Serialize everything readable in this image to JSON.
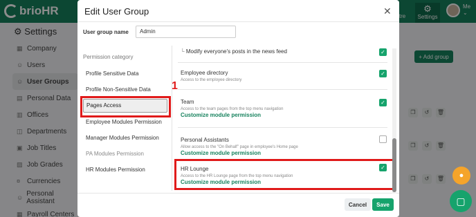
{
  "topbar": {
    "logo": "brioHR",
    "centre_label": "entre",
    "settings_label": "Settings",
    "user_label": "Me"
  },
  "page": {
    "title": "Settings",
    "add_group_label": "+ Add group"
  },
  "sidebar": {
    "items": [
      {
        "label": "Company",
        "icon": "building-icon"
      },
      {
        "label": "Users",
        "icon": "users-icon"
      },
      {
        "label": "User Groups",
        "icon": "user-groups-icon",
        "active": true
      },
      {
        "label": "Personal Data",
        "icon": "person-card-icon"
      },
      {
        "label": "Offices",
        "icon": "office-icon"
      },
      {
        "label": "Departments",
        "icon": "department-icon"
      },
      {
        "label": "Job Titles",
        "icon": "briefcase-icon"
      },
      {
        "label": "Job Grades",
        "icon": "grades-icon"
      },
      {
        "label": "Currencies",
        "icon": "currency-icon"
      },
      {
        "label": "Personal Assistant",
        "icon": "assistant-icon"
      },
      {
        "label": "Payroll Centers",
        "icon": "payroll-icon"
      }
    ]
  },
  "modal": {
    "title": "Edit User Group",
    "group_name_label": "User group name",
    "group_name_value": "Admin",
    "category_heading": "Permission category",
    "categories": [
      {
        "label": "Profile Sensitive Data"
      },
      {
        "label": "Profile Non-Sensitive Data"
      },
      {
        "label": "Pages Access",
        "active": true
      },
      {
        "label": "Employee Modules Permission"
      },
      {
        "label": "Manager Modules Permission"
      },
      {
        "label": "PA Modules Permission"
      },
      {
        "label": "HR Modules Permission"
      }
    ],
    "step_number": "1",
    "permissions": [
      {
        "name": "Modify everyone's posts in the news feed",
        "desc": "",
        "link": "",
        "checked": true
      },
      {
        "name": "Employee directory",
        "desc": "Access to the employee directory",
        "link": "",
        "checked": true
      },
      {
        "name": "Team",
        "desc": "Access to the team pages from the top menu navigation",
        "link": "Customize module permission",
        "checked": true
      },
      {
        "name": "Personal Assistants",
        "desc": "Allow access to the \"On Behalf\" page in employee's Home page",
        "link": "Customize module permission",
        "checked": false
      },
      {
        "name": "HR Lounge",
        "desc": "Access to the HR Lounge page from the top menu navigation",
        "link": "Customize module permission",
        "checked": true
      }
    ],
    "cancel_label": "Cancel",
    "save_label": "Save"
  },
  "colors": {
    "brand": "#16825d",
    "accent": "#16a36c",
    "highlight": "#e01a1a",
    "fab_orange": "#f5a42a"
  }
}
